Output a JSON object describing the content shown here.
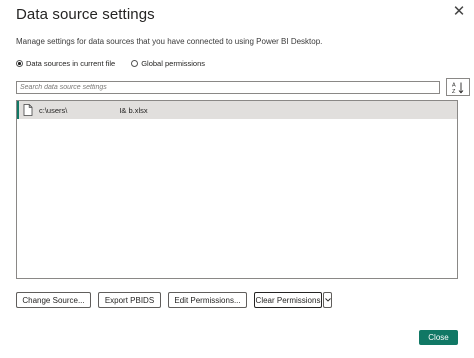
{
  "dialog": {
    "title": "Data source settings",
    "close_icon": "close-icon",
    "subtitle": "Manage settings for data sources that you have connected to using Power BI Desktop."
  },
  "scope": {
    "options": [
      {
        "label": "Data sources in current file",
        "checked": true
      },
      {
        "label": "Global permissions",
        "checked": false
      }
    ]
  },
  "search": {
    "placeholder": "Search data source settings",
    "value": ""
  },
  "sort_icon": "sort-az-icon",
  "sources": [
    {
      "icon": "file-icon",
      "path_start": "c:\\users\\",
      "path_end": "I& b.xlsx",
      "selected": true
    }
  ],
  "buttons": {
    "change_source": "Change Source...",
    "export_pbids": "Export PBIDS",
    "edit_permissions": "Edit Permissions...",
    "clear_permissions": "Clear Permissions",
    "clear_dropdown_icon": "chevron-down-icon",
    "close": "Close"
  },
  "colors": {
    "accent": "#117865",
    "selected_row": "#e1dfdd",
    "border": "#8a8886"
  }
}
